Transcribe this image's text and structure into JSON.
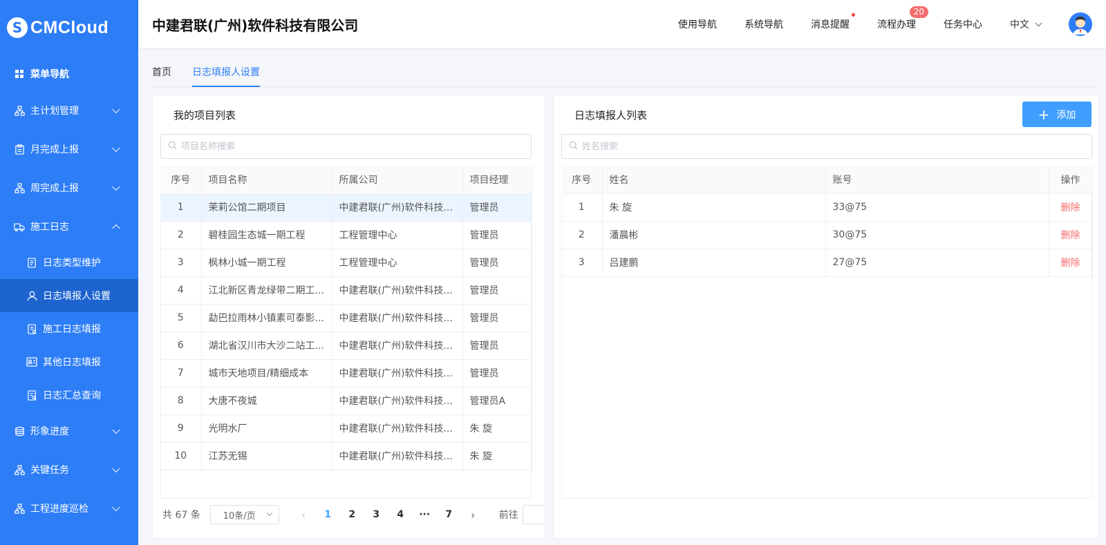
{
  "brand": {
    "mark": "S",
    "name": "CMCloud"
  },
  "sidebar": {
    "menu_header": "菜单导航",
    "items": [
      {
        "label": "主计划管理",
        "icon": "org-chart-icon"
      },
      {
        "label": "月完成上报",
        "icon": "clipboard-icon"
      },
      {
        "label": "周完成上报",
        "icon": "org-chart-icon"
      },
      {
        "label": "施工日志",
        "icon": "truck-icon"
      }
    ],
    "sub_items": [
      {
        "label": "日志类型维护",
        "icon": "document-icon"
      },
      {
        "label": "日志填报人设置",
        "icon": "user-icon"
      },
      {
        "label": "施工日志填报",
        "icon": "document-icon"
      },
      {
        "label": "其他日志填报",
        "icon": "id-card-icon"
      },
      {
        "label": "日志汇总查询",
        "icon": "document-search-icon"
      }
    ],
    "bottom_items": [
      {
        "label": "形象进度",
        "icon": "coins-icon"
      },
      {
        "label": "关键任务",
        "icon": "org-chart-icon"
      },
      {
        "label": "工程进度巡检",
        "icon": "org-chart-icon"
      }
    ]
  },
  "header": {
    "company": "中建君联(广州)软件科技有限公司",
    "nav": [
      "使用导航",
      "系统导航",
      "消息提醒",
      "流程办理",
      "任务中心"
    ],
    "process_badge": "20",
    "language": "中文"
  },
  "tabs": [
    "首页",
    "日志填报人设置"
  ],
  "left_panel": {
    "title": "我的项目列表",
    "search_placeholder": "项目名称搜索",
    "columns": [
      "序号",
      "项目名称",
      "所属公司",
      "项目经理"
    ],
    "rows": [
      [
        "1",
        "茉莉公馆二期项目",
        "中建君联(广州)软件科技...",
        "管理员"
      ],
      [
        "2",
        "碧桂园生态城一期工程",
        "工程管理中心",
        "管理员"
      ],
      [
        "3",
        "枫林小城一期工程",
        "工程管理中心",
        "管理员"
      ],
      [
        "4",
        "江北新区青龙绿带二期工...",
        "中建君联(广州)软件科技...",
        "管理员"
      ],
      [
        "5",
        "勐巴拉雨林小镇素可泰影...",
        "中建君联(广州)软件科技...",
        "管理员"
      ],
      [
        "6",
        "湖北省汉川市大沙二站工...",
        "中建君联(广州)软件科技...",
        "管理员"
      ],
      [
        "7",
        "城市天地项目/精细成本",
        "中建君联(广州)软件科技...",
        "管理员"
      ],
      [
        "8",
        "大唐不夜城",
        "中建君联(广州)软件科技...",
        "管理员A"
      ],
      [
        "9",
        "光明水厂",
        "中建君联(广州)软件科技...",
        "朱 旋"
      ],
      [
        "10",
        "江苏无锡",
        "中建君联(广州)软件科技...",
        "朱 旋"
      ]
    ],
    "pagination": {
      "total": "共 67 条",
      "page_size": "10条/页",
      "pages": [
        "1",
        "2",
        "3",
        "4",
        "···",
        "7"
      ],
      "current": "1",
      "goto_label": "前往"
    }
  },
  "right_panel": {
    "title": "日志填报人列表",
    "add_label": "添加",
    "search_placeholder": "姓名搜索",
    "columns": [
      "序号",
      "姓名",
      "账号",
      "操作"
    ],
    "rows": [
      [
        "1",
        "朱 旋",
        "33@75",
        "删除"
      ],
      [
        "2",
        "潘晨彬",
        "30@75",
        "删除"
      ],
      [
        "3",
        "吕建鹏",
        "27@75",
        "删除"
      ]
    ]
  },
  "colors": {
    "sidebar": "#2d7df6",
    "sidebar_active": "#1d64cf",
    "accent": "#409eff",
    "danger": "#f56c6c"
  }
}
